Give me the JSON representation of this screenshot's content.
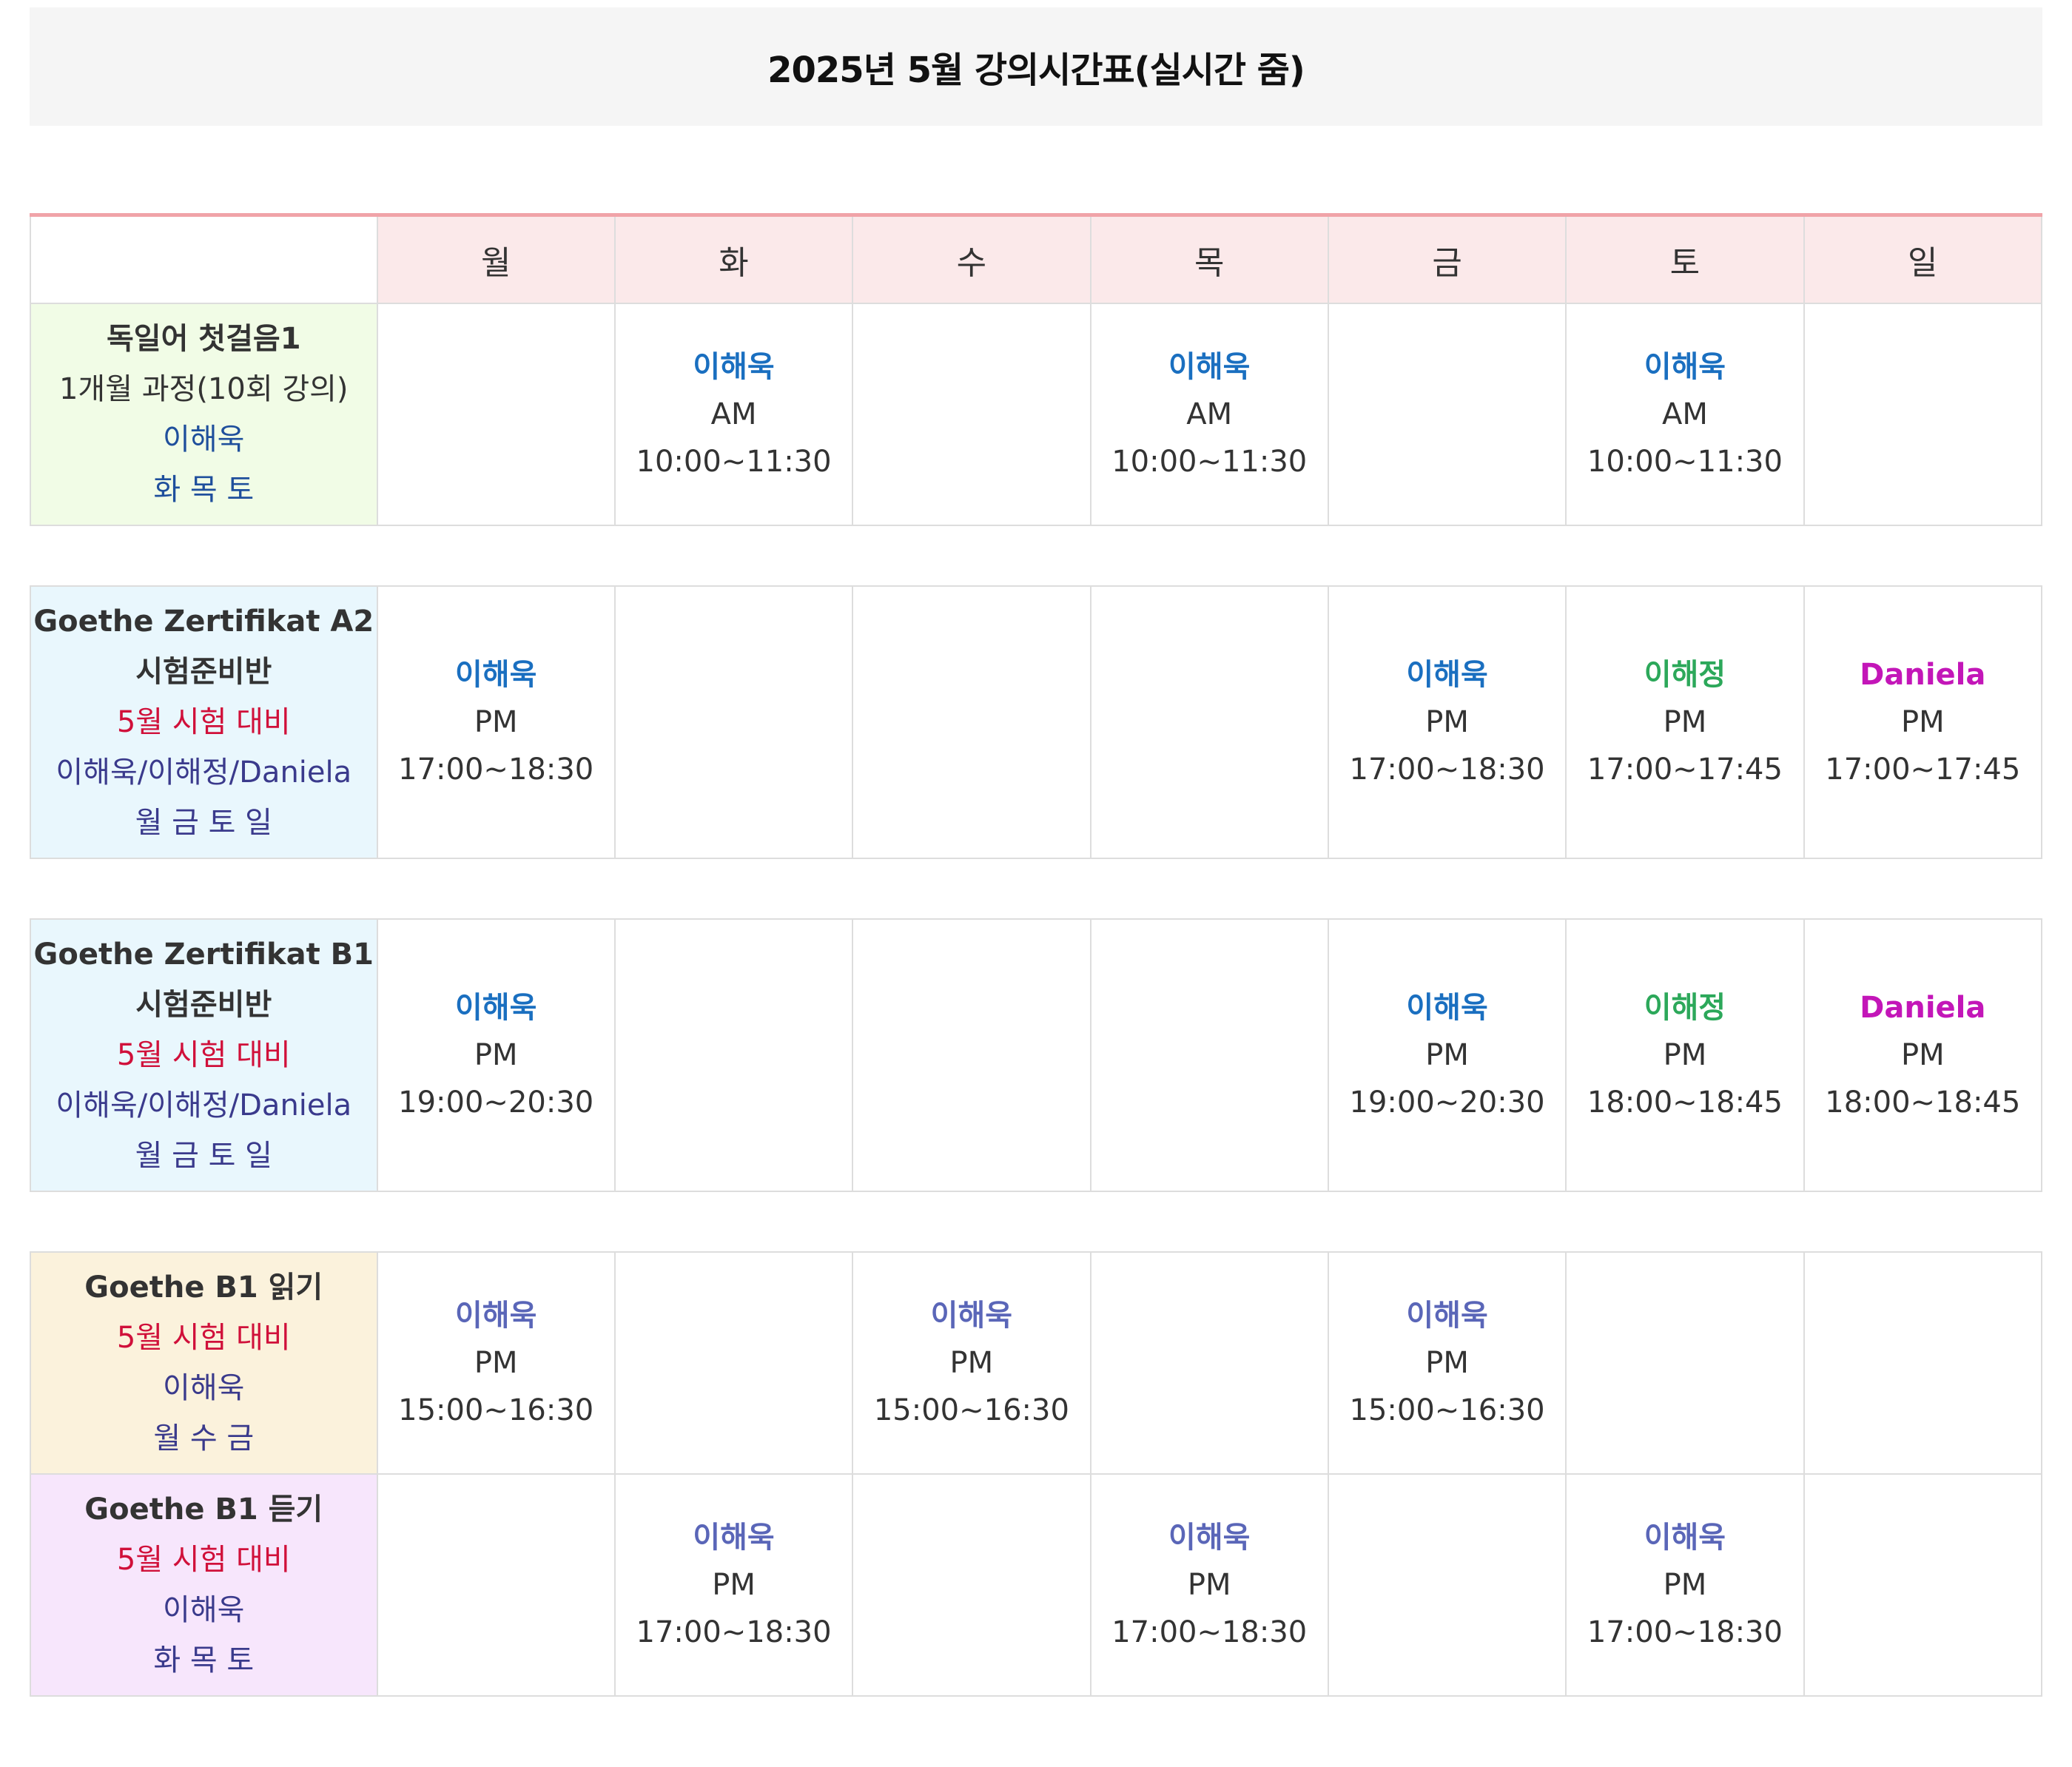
{
  "title": "2025년 5월 강의시간표(실시간 줌)",
  "colors": {
    "header_border": "#f0a3a8",
    "header_bg": "#fbe9ea",
    "title_bg": "#f5f5f5",
    "course1_bg": "#f1fce6",
    "course2_bg": "#e9f7fd",
    "course4_bg": "#fbf2dc",
    "course5_bg": "#f7e6fc",
    "teacher_blue": "#1a6fc0",
    "teacher_green": "#2ca85a",
    "teacher_purple": "#c316b8",
    "exam_red": "#d0103a"
  },
  "days": [
    "월",
    "화",
    "수",
    "목",
    "금",
    "토",
    "일"
  ],
  "courses": [
    {
      "name": "독일어 첫걸음1",
      "detail": "1개월 과정(10회 강의)",
      "teachers": "이해욱",
      "schedule_days": "화 목 토",
      "cells": [
        null,
        {
          "teacher": "이해욱",
          "time": "AM 10:00~11:30"
        },
        null,
        {
          "teacher": "이해욱",
          "time": "AM 10:00~11:30"
        },
        null,
        {
          "teacher": "이해욱",
          "time": "AM 10:00~11:30"
        },
        null
      ]
    },
    {
      "name": "Goethe Zertifikat A2",
      "subtitle": "시험준비반",
      "exam": "5월 시험 대비",
      "teachers": "이해욱/이해정/Daniela",
      "schedule_days": "월 금 토 일",
      "cells": [
        {
          "teacher": "이해욱",
          "time": "PM 17:00~18:30"
        },
        null,
        null,
        null,
        {
          "teacher": "이해욱",
          "time": "PM 17:00~18:30"
        },
        {
          "teacher": "이해정",
          "time": "PM 17:00~17:45"
        },
        {
          "teacher": "Daniela",
          "time": "PM 17:00~17:45"
        }
      ]
    },
    {
      "name": "Goethe Zertifikat B1",
      "subtitle": "시험준비반",
      "exam": "5월 시험 대비",
      "teachers": "이해욱/이해정/Daniela",
      "schedule_days": "월 금 토 일",
      "cells": [
        {
          "teacher": "이해욱",
          "time": "PM 19:00~20:30"
        },
        null,
        null,
        null,
        {
          "teacher": "이해욱",
          "time": "PM 19:00~20:30"
        },
        {
          "teacher": "이해정",
          "time": "PM 18:00~18:45"
        },
        {
          "teacher": "Daniela",
          "time": "PM 18:00~18:45"
        }
      ]
    },
    {
      "name": "Goethe B1 읽기",
      "exam": "5월 시험 대비",
      "teachers": "이해욱",
      "schedule_days": "월 수 금",
      "cells": [
        {
          "teacher": "이해욱",
          "time": "PM 15:00~16:30"
        },
        null,
        {
          "teacher": "이해욱",
          "time": "PM 15:00~16:30"
        },
        null,
        {
          "teacher": "이해욱",
          "time": "PM 15:00~16:30"
        },
        null,
        null
      ]
    },
    {
      "name": "Goethe B1 듣기",
      "exam": "5월 시험 대비",
      "teachers": "이해욱",
      "schedule_days": "화 목 토",
      "cells": [
        null,
        {
          "teacher": "이해욱",
          "time": "PM 17:00~18:30"
        },
        null,
        {
          "teacher": "이해욱",
          "time": "PM 17:00~18:30"
        },
        null,
        {
          "teacher": "이해욱",
          "time": "PM 17:00~18:30"
        },
        null
      ]
    }
  ]
}
